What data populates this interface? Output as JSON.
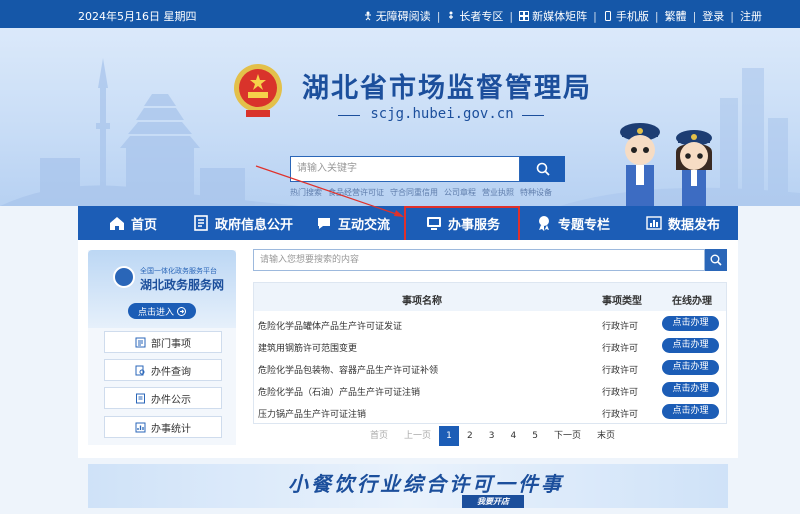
{
  "topbar": {
    "date": "2024年5月16日 星期四",
    "links": [
      "无障碍阅读",
      "长者专区",
      "新媒体矩阵",
      "手机版",
      "繁體",
      "登录",
      "注册"
    ]
  },
  "header": {
    "title": "湖北省市场监督管理局",
    "domain": "scjg.hubei.gov.cn",
    "search_placeholder": "请输入关键字",
    "hot_links": [
      "热门搜索",
      "食品经营许可证",
      "守合同重信用",
      "公司章程",
      "营业执照",
      "特种设备"
    ]
  },
  "nav": {
    "items": [
      "首页",
      "政府信息公开",
      "互动交流",
      "办事服务",
      "专题专栏",
      "数据发布"
    ],
    "active": "办事服务"
  },
  "side": {
    "subtitle": "全国一体化政务服务平台",
    "title": "湖北政务服务网",
    "enter_label": "点击进入",
    "buttons": [
      "部门事项",
      "办件查询",
      "办件公示",
      "办事统计"
    ]
  },
  "item_search": {
    "placeholder": "请输入您想要搜索的内容"
  },
  "table": {
    "headers": [
      "事项名称",
      "事项类型",
      "在线办理"
    ],
    "rows": [
      {
        "name": "危险化学品罐体产品生产许可证发证",
        "type": "行政许可",
        "op": "点击办理"
      },
      {
        "name": "建筑用钢筋许可范围变更",
        "type": "行政许可",
        "op": "点击办理"
      },
      {
        "name": "危险化学品包装物、容器产品生产许可证补领",
        "type": "行政许可",
        "op": "点击办理"
      },
      {
        "name": "危险化学品（石油）产品生产许可证注销",
        "type": "行政许可",
        "op": "点击办理"
      },
      {
        "name": "压力锅产品生产许可证注销",
        "type": "行政许可",
        "op": "点击办理"
      }
    ]
  },
  "pager": {
    "first": "首页",
    "prev": "上一页",
    "pages": [
      "1",
      "2",
      "3",
      "4",
      "5"
    ],
    "current": "1",
    "next": "下一页",
    "last": "末页"
  },
  "banner": {
    "text": "小餐饮行业综合许可一件事",
    "sub": "我要开店"
  },
  "colors": {
    "primary": "#1c5db6",
    "highlight": "#e0312b"
  }
}
